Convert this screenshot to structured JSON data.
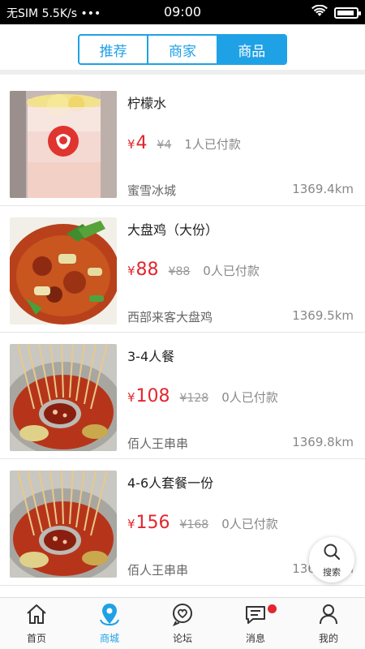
{
  "status_bar": {
    "carrier": "无SIM",
    "speed": "5.5K/s",
    "dots": "•••",
    "time": "09:00"
  },
  "segments": [
    {
      "label": "推荐",
      "active": false
    },
    {
      "label": "商家",
      "active": false
    },
    {
      "label": "商品",
      "active": true
    }
  ],
  "items": [
    {
      "name": "柠檬水",
      "price": "4",
      "original_price": "¥4",
      "paid": "1人已付款",
      "shop": "蜜雪冰城",
      "distance": "1369.4km",
      "image": "lemon-water-cup"
    },
    {
      "name": "大盘鸡（大份）",
      "price": "88",
      "original_price": "¥88",
      "paid": "0人已付款",
      "shop": "西部来客大盘鸡",
      "distance": "1369.5km",
      "image": "big-plate-chicken"
    },
    {
      "name": "3-4人餐",
      "price": "108",
      "original_price": "¥128",
      "paid": "0人已付款",
      "shop": "佰人王串串",
      "distance": "1369.8km",
      "image": "skewer-hotpot"
    },
    {
      "name": "4-6人套餐一份",
      "price": "156",
      "original_price": "¥168",
      "paid": "0人已付款",
      "shop": "佰人王串串",
      "distance": "1369.8km",
      "image": "skewer-hotpot"
    }
  ],
  "currency_symbol": "¥",
  "search_fab": {
    "label": "搜索",
    "icon": "search-icon"
  },
  "tabbar": [
    {
      "label": "首页",
      "icon": "home-icon",
      "active": false
    },
    {
      "label": "商城",
      "icon": "mall-location-icon",
      "active": true
    },
    {
      "label": "论坛",
      "icon": "forum-heart-icon",
      "active": false
    },
    {
      "label": "消息",
      "icon": "message-icon",
      "active": false,
      "badge": true
    },
    {
      "label": "我的",
      "icon": "profile-icon",
      "active": false
    }
  ],
  "colors": {
    "accent": "#1fa1e6",
    "price": "#e3262f",
    "badge": "#e3262f"
  }
}
